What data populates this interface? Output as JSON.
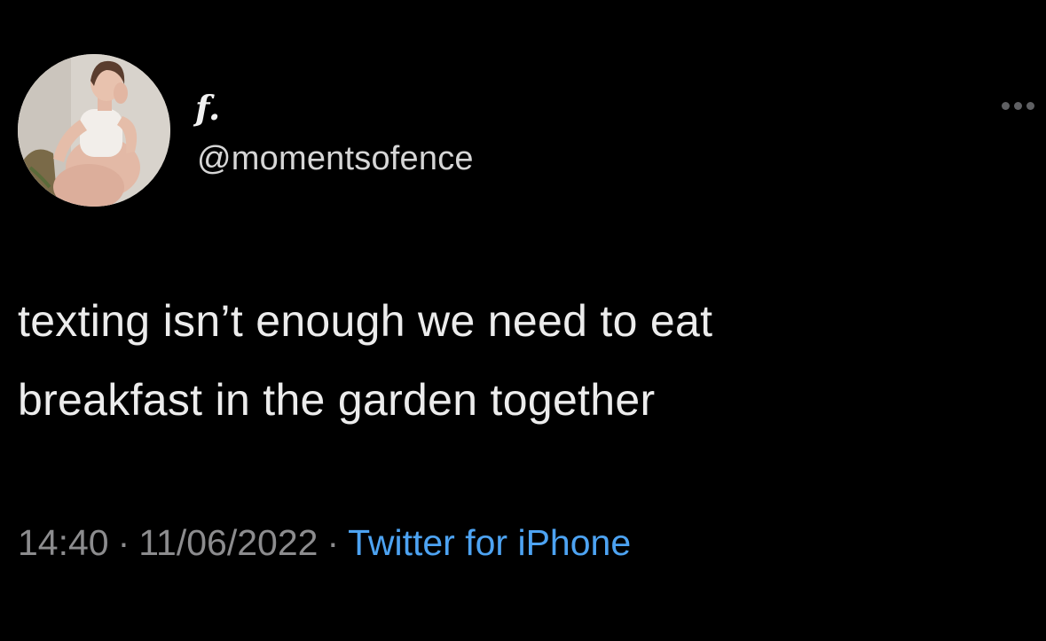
{
  "user": {
    "display_name": "f.",
    "handle": "@momentsofence",
    "avatar_icon": "profile-photo"
  },
  "tweet": {
    "text_lines": [
      "texting isn’t enough we need to eat",
      "breakfast in the garden together"
    ],
    "time": "14:40",
    "date": "11/06/2022",
    "separator": "·",
    "source": "Twitter for iPhone"
  },
  "menu": {
    "icon": "more-horizontal-icon"
  },
  "colors": {
    "background": "#000000",
    "primary_text": "#ececec",
    "secondary_text": "#8c8c8e",
    "link": "#4da3f2"
  }
}
